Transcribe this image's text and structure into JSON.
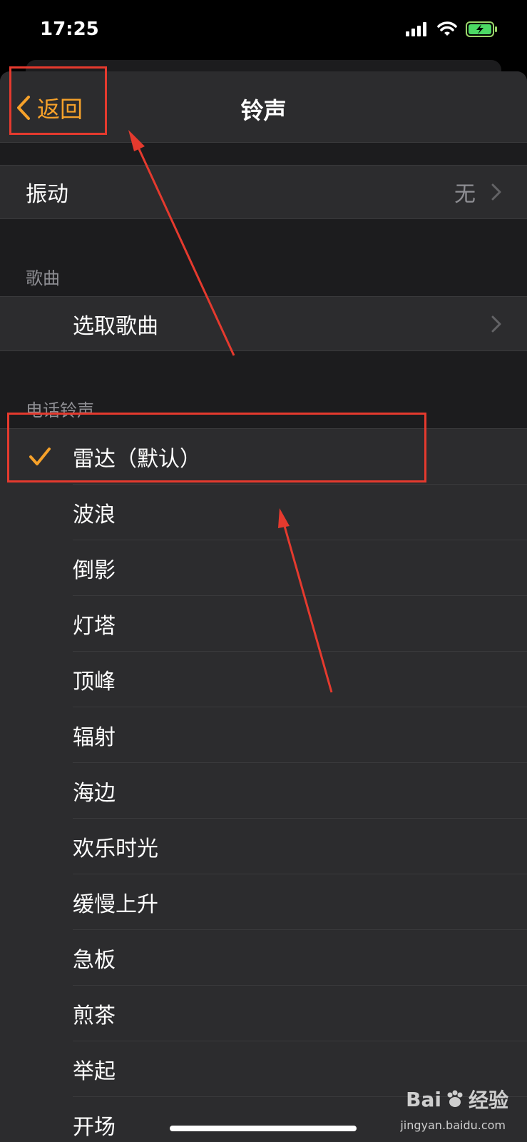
{
  "status": {
    "time": "17:25",
    "icons": [
      "signal-icon",
      "wifi-icon",
      "battery-charging-icon"
    ]
  },
  "nav": {
    "back_label": "返回",
    "title": "铃声"
  },
  "vibration": {
    "label": "振动",
    "value": "无"
  },
  "songs_section": {
    "header": "歌曲",
    "pick_song": "选取歌曲"
  },
  "ringtones_section": {
    "header": "电话铃声",
    "items": [
      {
        "label": "雷达（默认）",
        "selected": true
      },
      {
        "label": "波浪"
      },
      {
        "label": "倒影"
      },
      {
        "label": "灯塔"
      },
      {
        "label": "顶峰"
      },
      {
        "label": "辐射"
      },
      {
        "label": "海边"
      },
      {
        "label": "欢乐时光"
      },
      {
        "label": "缓慢上升"
      },
      {
        "label": "急板"
      },
      {
        "label": "煎茶"
      },
      {
        "label": "举起"
      },
      {
        "label": "开场"
      }
    ]
  },
  "watermark": {
    "brand": "Bai",
    "brand_suffix": "经验",
    "url": "jingyan.baidu.com"
  },
  "colors": {
    "accent": "#f6a12a",
    "annotation": "#e53a2e"
  }
}
